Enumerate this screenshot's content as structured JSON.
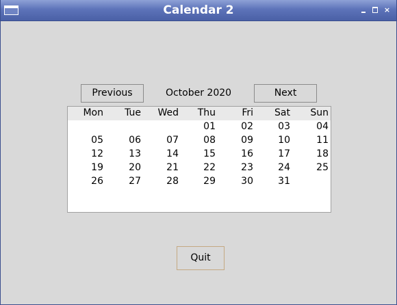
{
  "window": {
    "title": "Calendar 2",
    "close_glyph": "×"
  },
  "nav": {
    "previous_label": "Previous",
    "next_label": "Next",
    "month_label": "October 2020"
  },
  "calendar": {
    "weekdays": [
      "Mon",
      "Tue",
      "Wed",
      "Thu",
      "Fri",
      "Sat",
      "Sun"
    ],
    "weeks": [
      [
        "",
        "",
        "",
        "01",
        "02",
        "03",
        "04"
      ],
      [
        "05",
        "06",
        "07",
        "08",
        "09",
        "10",
        "11"
      ],
      [
        "12",
        "13",
        "14",
        "15",
        "16",
        "17",
        "18"
      ],
      [
        "19",
        "20",
        "21",
        "22",
        "23",
        "24",
        "25"
      ],
      [
        "26",
        "27",
        "28",
        "29",
        "30",
        "31",
        ""
      ]
    ]
  },
  "quit_label": "Quit",
  "colors": {
    "titlebar": "#5d73b9",
    "window_bg": "#d9d9d9",
    "calendar_bg": "#ffffff"
  }
}
